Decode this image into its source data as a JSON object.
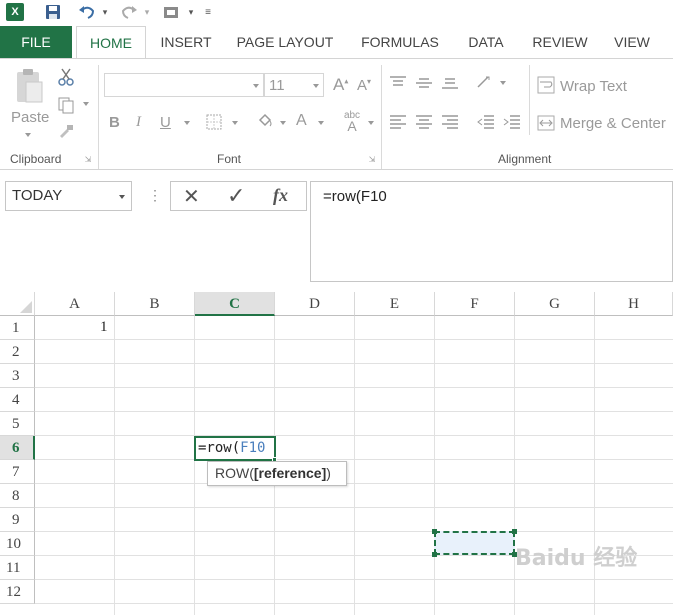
{
  "app": {
    "logo": "X",
    "colors": {
      "accent": "#217346",
      "ref_blue": "#4a7fbd"
    }
  },
  "quick_access": [
    {
      "name": "save-icon"
    },
    {
      "name": "undo-icon"
    },
    {
      "name": "redo-icon"
    },
    {
      "name": "touch-mode-icon"
    },
    {
      "name": "customize-qat-icon"
    }
  ],
  "tabs": [
    "FILE",
    "HOME",
    "INSERT",
    "PAGE LAYOUT",
    "FORMULAS",
    "DATA",
    "REVIEW",
    "VIEW"
  ],
  "active_tab": "HOME",
  "ribbon": {
    "clipboard": {
      "label": "Clipboard",
      "paste_label": "Paste"
    },
    "font": {
      "label": "Font",
      "font_name": "",
      "font_size": "11",
      "bold": "B",
      "italic": "I",
      "underline": "U",
      "grow": "A",
      "shrink": "A",
      "font_color": "A"
    },
    "alignment": {
      "label": "Alignment",
      "wrap_text": "Wrap Text",
      "merge_center": "Merge & Center"
    }
  },
  "formula_bar": {
    "name_box": "TODAY",
    "cancel": "✕",
    "enter": "✓",
    "fx": "fx",
    "formula": "=row(F10"
  },
  "sheet": {
    "columns": [
      "A",
      "B",
      "C",
      "D",
      "E",
      "F",
      "G",
      "H"
    ],
    "selected_column": "C",
    "rows": [
      "1",
      "2",
      "3",
      "4",
      "5",
      "6",
      "7",
      "8",
      "9",
      "10",
      "11",
      "12"
    ],
    "selected_row": "6",
    "cells": {
      "A1": "1"
    },
    "active_cell": {
      "address": "C6",
      "prefix": "=row(",
      "reference": "F10"
    },
    "tooltip": {
      "func": "ROW(",
      "arg": "[reference]",
      "close": ")"
    },
    "marquee_cell": "F10"
  },
  "watermark": "Baidu 经验"
}
